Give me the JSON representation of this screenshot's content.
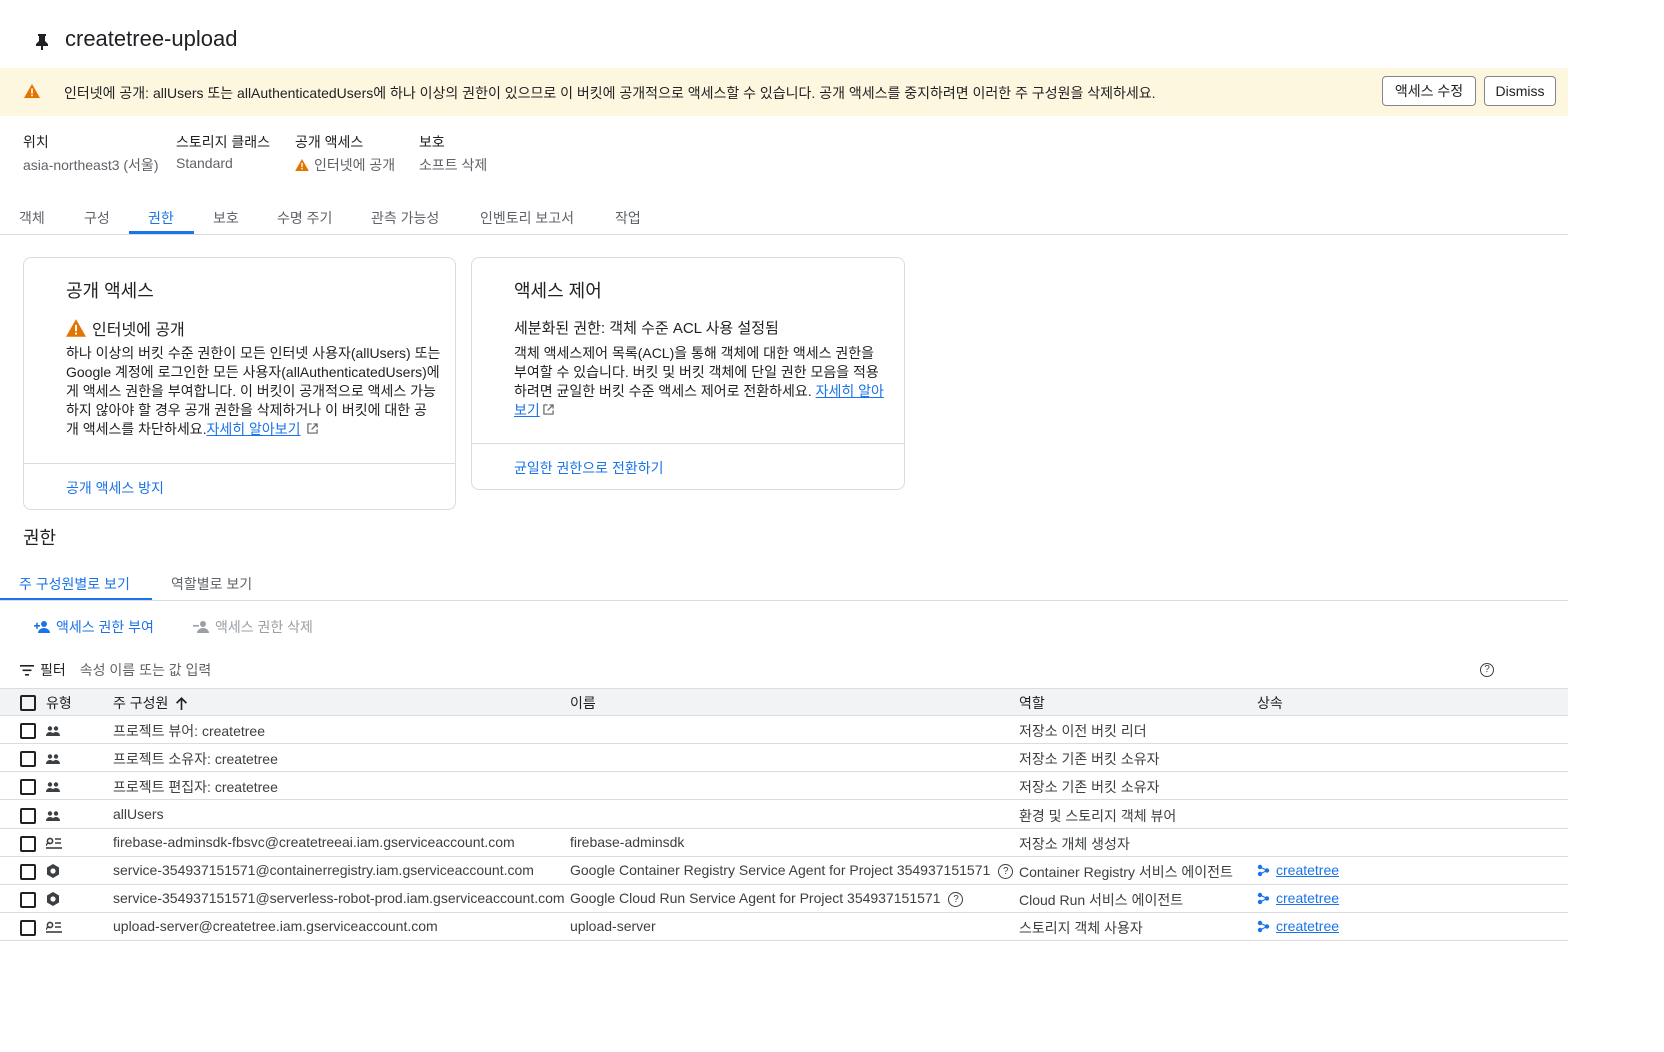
{
  "header": {
    "title": "createtree-upload",
    "pin_icon": "pin-icon"
  },
  "banner": {
    "text": "인터넷에 공개: allUsers 또는 allAuthenticatedUsers에 하나 이상의 권한이 있으므로 이 버킷에 공개적으로 액세스할 수 있습니다. 공개 액세스를 중지하려면 이러한 주 구성원을 삭제하세요.",
    "edit_button": "액세스 수정",
    "dismiss_button": "Dismiss",
    "warning_color": "#e37400"
  },
  "info": {
    "location_label": "위치",
    "location_value": "asia-northeast3 (서울)",
    "storage_class_label": "스토리지 클래스",
    "storage_class_value": "Standard",
    "public_access_label": "공개 액세스",
    "public_access_value": "인터넷에 공개",
    "protection_label": "보호",
    "protection_value": "소프트 삭제"
  },
  "tabs": [
    "객체",
    "구성",
    "권한",
    "보호",
    "수명 주기",
    "관측 가능성",
    "인벤토리 보고서",
    "작업"
  ],
  "active_tab": "권한",
  "public_card": {
    "title": "공개 액세스",
    "status": "인터넷에 공개",
    "body_lines": [
      "하나 이상의 버킷 수준 권한이 모든 인터넷 사용자(allUsers) 또는",
      "Google 계정에 로그인한 모든 사용자(allAuthenticatedUsers)에",
      "게 액세스 권한을 부여합니다. 이 버킷이 공개적으로 액세스 가능",
      "하지 않아야 할 경우 공개 권한을 삭제하거나 이 버킷에 대한 공",
      "개 액세스를 차단하세요."
    ],
    "learn_more": "자세히 알아보기",
    "action": "공개 액세스 방지"
  },
  "access_card": {
    "title": "액세스 제어",
    "subtitle": "세분화된 권한: 객체 수준 ACL 사용 설정됨",
    "body_lines": [
      "객체 액세스제어 목록(ACL)을 통해 객체에 대한 액세스 권한을",
      "부여할 수 있습니다. 버킷 및 버킷 객체에 단일 권한 모음을 적용",
      "하려면 균일한 버킷 수준 액세스 제어로 전환하세요."
    ],
    "learn_more_1": "자세히 알아",
    "learn_more_2": "보기",
    "action": "균일한 권한으로 전환하기"
  },
  "permissions": {
    "title": "권한",
    "view_tabs": [
      "주 구성원별로 보기",
      "역할별로 보기"
    ],
    "grant_access": "액세스 권한 부여",
    "remove_access": "액세스 권한 삭제",
    "filter_label": "필터",
    "filter_placeholder": "속성 이름 또는 값 입력"
  },
  "table": {
    "headers": {
      "type": "유형",
      "principal": "주 구성원",
      "name": "이름",
      "role": "역할",
      "inheritance": "상속"
    },
    "rows": [
      {
        "type_icon": "group-icon",
        "principal": "프로젝트 뷰어: createtree",
        "name": "",
        "role": "저장소 이전 버킷 리더",
        "inheritance": ""
      },
      {
        "type_icon": "group-icon",
        "principal": "프로젝트 소유자: createtree",
        "name": "",
        "role": "저장소 기존 버킷 소유자",
        "inheritance": ""
      },
      {
        "type_icon": "group-icon",
        "principal": "프로젝트 편집자: createtree",
        "name": "",
        "role": "저장소 기존 버킷 소유자",
        "inheritance": ""
      },
      {
        "type_icon": "group-icon",
        "principal": "allUsers",
        "name": "",
        "role": "환경 및 스토리지 객체 뷰어",
        "inheritance": ""
      },
      {
        "type_icon": "service-account-icon",
        "principal": "firebase-adminsdk-fbsvc@createtreeai.iam.gserviceaccount.com",
        "name": "firebase-adminsdk",
        "role": "저장소 개체 생성자",
        "inheritance": ""
      },
      {
        "type_icon": "service-agent-icon",
        "principal": "service-354937151571@containerregistry.iam.gserviceaccount.com",
        "name": "Google Container Registry Service Agent for Project 354937151571",
        "role": "Container Registry 서비스 에이전트",
        "inheritance": "createtree"
      },
      {
        "type_icon": "service-agent-icon",
        "principal": "service-354937151571@serverless-robot-prod.iam.gserviceaccount.com",
        "name": "Google Cloud Run Service Agent for Project 354937151571",
        "role": "Cloud Run 서비스 에이전트",
        "inheritance": "createtree"
      },
      {
        "type_icon": "service-account-icon",
        "principal": "upload-server@createtree.iam.gserviceaccount.com",
        "name": "upload-server",
        "role": "스토리지 객체 사용자",
        "inheritance": "createtree"
      }
    ]
  }
}
